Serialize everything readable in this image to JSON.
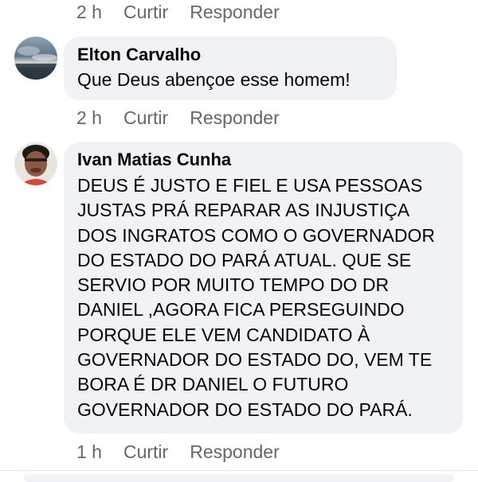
{
  "comments": [
    {
      "time": "2 h",
      "like_label": "Curtir",
      "reply_label": "Responder"
    },
    {
      "author": "Elton Carvalho",
      "text": "Que Deus abençoe esse homem!",
      "time": "2 h",
      "like_label": "Curtir",
      "reply_label": "Responder"
    },
    {
      "author": "Ivan Matias Cunha",
      "text_lines": [
        "DEUS É JUSTO E FIEL E USA PESSOAS",
        "JUSTAS PRÁ REPARAR AS INJUSTIÇA",
        "DOS INGRATOS COMO O GOVERNADOR",
        "DO ESTADO DO PARÁ ATUAL. QUE SE",
        "SERVIO POR MUITO TEMPO DO DR",
        "DANIEL ,AGORA FICA PERSEGUINDO",
        "PORQUE ELE VEM CANDIDATO À",
        "GOVERNADOR DO ESTADO DO, VEM TE",
        "BORA É DR DANIEL O FUTURO",
        "GOVERNADOR DO ESTADO DO PARÁ."
      ],
      "time": "1 h",
      "like_label": "Curtir",
      "reply_label": "Responder"
    }
  ],
  "colors": {
    "bubble_bg": "#f0f2f5",
    "meta_text": "#65676b",
    "body_text": "#050505"
  }
}
